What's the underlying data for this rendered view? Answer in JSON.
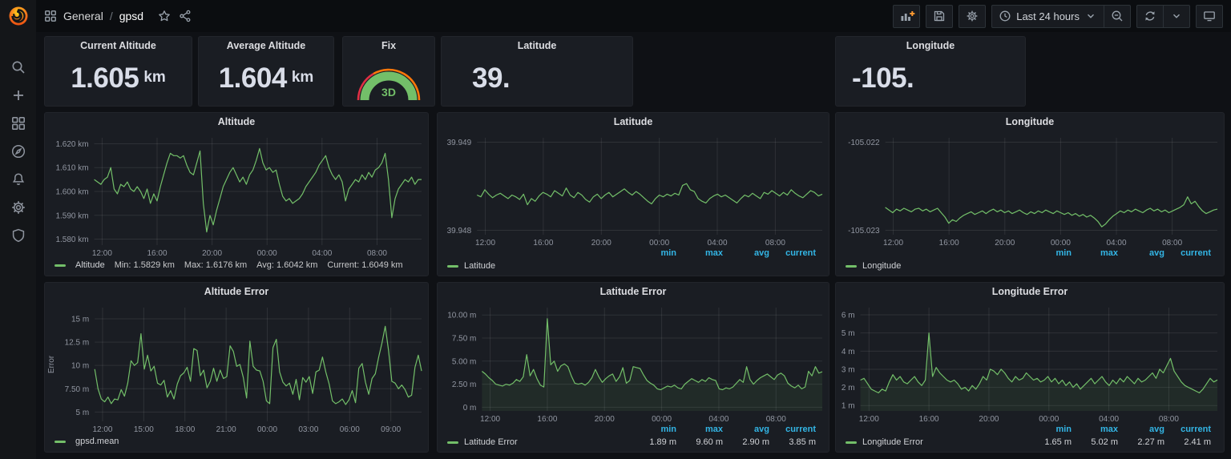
{
  "topbar": {
    "breadcrumb_section": "General",
    "breadcrumb_separator": "/",
    "breadcrumb_page": "gpsd",
    "time_range": "Last 24 hours"
  },
  "colors": {
    "series_green": "#73bf69",
    "legend_header_blue": "#33b5e5",
    "gauge_red": "#e02f44",
    "gauge_orange": "#ff780a",
    "add_panel_plus_orange": "#ff9830"
  },
  "stats": [
    {
      "title": "Current Altitude",
      "value": "1.605",
      "unit": "km"
    },
    {
      "title": "Average Altitude",
      "value": "1.604",
      "unit": "km"
    },
    {
      "title": "Fix",
      "value": "3D"
    },
    {
      "title": "Latitude",
      "value": "39."
    },
    {
      "title": "Longitude",
      "value": "-105."
    }
  ],
  "chart_data": [
    {
      "type": "line",
      "title": "Altitude",
      "color": "#73bf69",
      "fill": false,
      "ylim": [
        1.5775,
        1.6225
      ],
      "y_ticks": [
        {
          "v": 1.58,
          "label": "1.580 km"
        },
        {
          "v": 1.59,
          "label": "1.590 km"
        },
        {
          "v": 1.6,
          "label": "1.600 km"
        },
        {
          "v": 1.61,
          "label": "1.610 km"
        },
        {
          "v": 1.62,
          "label": "1.620 km"
        }
      ],
      "x_ticks": [
        "12:00",
        "16:00",
        "20:00",
        "00:00",
        "04:00",
        "08:00"
      ],
      "x_start": 0.024,
      "x_step": 0.168,
      "values": [
        1.605,
        1.604,
        1.603,
        1.605,
        1.606,
        1.61,
        1.601,
        1.599,
        1.603,
        1.602,
        1.604,
        1.601,
        1.6,
        1.602,
        1.6,
        1.597,
        1.601,
        1.595,
        1.599,
        1.596,
        1.602,
        1.607,
        1.612,
        1.616,
        1.615,
        1.615,
        1.614,
        1.615,
        1.611,
        1.608,
        1.607,
        1.612,
        1.617,
        1.595,
        1.583,
        1.59,
        1.586,
        1.592,
        1.597,
        1.602,
        1.605,
        1.608,
        1.61,
        1.607,
        1.604,
        1.606,
        1.603,
        1.607,
        1.609,
        1.613,
        1.618,
        1.612,
        1.609,
        1.61,
        1.608,
        1.609,
        1.603,
        1.598,
        1.596,
        1.597,
        1.595,
        1.596,
        1.597,
        1.599,
        1.602,
        1.604,
        1.606,
        1.608,
        1.611,
        1.613,
        1.615,
        1.61,
        1.607,
        1.605,
        1.607,
        1.604,
        1.596,
        1.601,
        1.603,
        1.605,
        1.604,
        1.607,
        1.605,
        1.608,
        1.606,
        1.609,
        1.61,
        1.612,
        1.616,
        1.605,
        1.589,
        1.597,
        1.601,
        1.603,
        1.605,
        1.604,
        1.606,
        1.603,
        1.605,
        1.605
      ],
      "legend": {
        "style": "inline",
        "label": "Altitude",
        "stats": [
          "Min: 1.5829 km",
          "Max: 1.6176 km",
          "Avg: 1.6042 km",
          "Current: 1.6049 km"
        ]
      }
    },
    {
      "type": "line",
      "title": "Latitude",
      "color": "#73bf69",
      "fill": false,
      "ylim": [
        39.94795,
        39.94905
      ],
      "y_ticks": [
        {
          "v": 39.948,
          "label": "39.948"
        },
        {
          "v": 39.949,
          "label": "39.949"
        }
      ],
      "x_ticks": [
        "12:00",
        "16:00",
        "20:00",
        "00:00",
        "04:00",
        "08:00"
      ],
      "x_start": 0.024,
      "x_step": 0.168,
      "values": [
        39.9484,
        39.94838,
        39.94846,
        39.94841,
        39.94837,
        39.9484,
        39.94842,
        39.94839,
        39.94836,
        39.9484,
        39.94838,
        39.94835,
        39.94841,
        39.94829,
        39.94836,
        39.94833,
        39.94839,
        39.94843,
        39.94841,
        39.94838,
        39.94845,
        39.94842,
        39.94839,
        39.94848,
        39.9484,
        39.94837,
        39.94843,
        39.9484,
        39.94835,
        39.94832,
        39.94838,
        39.94841,
        39.94836,
        39.9484,
        39.94843,
        39.94838,
        39.94841,
        39.94844,
        39.94847,
        39.94843,
        39.9484,
        39.94844,
        39.94841,
        39.94837,
        39.94833,
        39.9483,
        39.94836,
        39.9484,
        39.94838,
        39.94841,
        39.94839,
        39.94842,
        39.9484,
        39.94851,
        39.94853,
        39.94846,
        39.94844,
        39.94836,
        39.94833,
        39.94831,
        39.94836,
        39.94839,
        39.94841,
        39.94838,
        39.9484,
        39.94837,
        39.94834,
        39.94831,
        39.94836,
        39.9484,
        39.94838,
        39.94842,
        39.94839,
        39.94836,
        39.94843,
        39.94841,
        39.94845,
        39.94842,
        39.94839,
        39.94843,
        39.9484,
        39.94846,
        39.94842,
        39.94839,
        39.94837,
        39.94841,
        39.94845,
        39.94843,
        39.94839,
        39.94841
      ],
      "legend": {
        "style": "table",
        "label": "Latitude",
        "headers": [
          "min",
          "max",
          "avg",
          "current"
        ],
        "values": [
          "",
          "",
          "",
          ""
        ]
      }
    },
    {
      "type": "line",
      "title": "Longitude",
      "color": "#73bf69",
      "fill": false,
      "ylim": [
        -105.02305,
        -105.02195
      ],
      "y_ticks": [
        {
          "v": -105.023,
          "label": "-105.023"
        },
        {
          "v": -105.022,
          "label": "-105.022"
        }
      ],
      "x_ticks": [
        "12:00",
        "16:00",
        "20:00",
        "00:00",
        "04:00",
        "08:00"
      ],
      "x_start": 0.024,
      "x_step": 0.168,
      "values": [
        -105.02274,
        -105.02277,
        -105.0228,
        -105.02276,
        -105.02278,
        -105.02275,
        -105.02277,
        -105.02279,
        -105.02276,
        -105.02275,
        -105.02278,
        -105.02276,
        -105.02279,
        -105.02277,
        -105.02275,
        -105.0228,
        -105.02285,
        -105.02292,
        -105.02288,
        -105.0229,
        -105.02286,
        -105.02283,
        -105.02281,
        -105.02279,
        -105.02282,
        -105.0228,
        -105.02278,
        -105.02281,
        -105.02278,
        -105.02276,
        -105.02279,
        -105.02277,
        -105.0228,
        -105.02278,
        -105.02281,
        -105.02279,
        -105.02277,
        -105.0228,
        -105.02282,
        -105.02279,
        -105.02281,
        -105.02278,
        -105.0228,
        -105.02277,
        -105.02279,
        -105.02281,
        -105.02278,
        -105.0228,
        -105.02282,
        -105.0228,
        -105.02283,
        -105.02281,
        -105.02284,
        -105.02282,
        -105.02285,
        -105.02283,
        -105.02286,
        -105.0229,
        -105.02296,
        -105.02293,
        -105.02288,
        -105.02284,
        -105.02281,
        -105.02278,
        -105.0228,
        -105.02277,
        -105.02279,
        -105.02276,
        -105.02278,
        -105.0228,
        -105.02277,
        -105.02275,
        -105.02278,
        -105.02276,
        -105.02279,
        -105.02277,
        -105.0228,
        -105.02278,
        -105.02276,
        -105.02274,
        -105.02271,
        -105.02262,
        -105.0227,
        -105.02267,
        -105.02273,
        -105.02278,
        -105.02281,
        -105.02279,
        -105.02277,
        -105.02276
      ],
      "legend": {
        "style": "table",
        "label": "Longitude",
        "headers": [
          "min",
          "max",
          "avg",
          "current"
        ],
        "values": [
          "",
          "",
          "",
          ""
        ]
      }
    },
    {
      "type": "line",
      "title": "Altitude Error",
      "color": "#73bf69",
      "fill": false,
      "y_label": "Error",
      "ylim": [
        4.0,
        16.2
      ],
      "y_ticks": [
        {
          "v": 5,
          "label": "5 m"
        },
        {
          "v": 7.5,
          "label": "7.50 m"
        },
        {
          "v": 10,
          "label": "10 m"
        },
        {
          "v": 12.5,
          "label": "12.5 m"
        },
        {
          "v": 15,
          "label": "15 m"
        }
      ],
      "x_ticks": [
        "12:00",
        "15:00",
        "18:00",
        "21:00",
        "00:00",
        "03:00",
        "06:00",
        "09:00"
      ],
      "x_start": 0.024,
      "x_step": 0.126,
      "values": [
        9.6,
        7.5,
        6.4,
        6.1,
        6.6,
        5.9,
        6.4,
        6.3,
        7.4,
        6.7,
        8.1,
        10.5,
        10.0,
        10.3,
        13.4,
        9.6,
        11.1,
        9.4,
        9.9,
        8.1,
        7.9,
        8.4,
        6.6,
        7.3,
        6.4,
        8.0,
        8.9,
        9.2,
        9.8,
        8.3,
        11.8,
        11.6,
        8.9,
        9.5,
        7.6,
        8.3,
        9.7,
        8.3,
        9.5,
        8.6,
        8.8,
        12.1,
        11.5,
        9.9,
        10.1,
        8.7,
        6.5,
        12.6,
        9.9,
        9.5,
        9.4,
        8.3,
        6.2,
        5.9,
        11.9,
        12.8,
        9.3,
        8.2,
        7.8,
        8.1,
        6.9,
        8.5,
        6.3,
        8.7,
        8.2,
        8.8,
        7.0,
        9.3,
        9.5,
        10.9,
        9.3,
        8.0,
        6.2,
        5.9,
        6.1,
        6.4,
        5.8,
        6.3,
        7.3,
        6.0,
        9.7,
        10.2,
        8.2,
        6.9,
        8.6,
        9.1,
        10.9,
        12.4,
        14.2,
        11.6,
        8.3,
        8.1,
        7.5,
        7.9,
        7.4,
        6.6,
        6.8,
        9.8,
        11.1,
        9.4
      ],
      "legend": {
        "style": "inline",
        "label": "gpsd.mean",
        "stats": []
      }
    },
    {
      "type": "line",
      "title": "Latitude Error",
      "color": "#73bf69",
      "fill": true,
      "ylim": [
        -0.4,
        10.8
      ],
      "y_ticks": [
        {
          "v": 0,
          "label": "0 m"
        },
        {
          "v": 2.5,
          "label": "2.50 m"
        },
        {
          "v": 5,
          "label": "5.00 m"
        },
        {
          "v": 7.5,
          "label": "7.50 m"
        },
        {
          "v": 10,
          "label": "10.00 m"
        }
      ],
      "x_ticks": [
        "12:00",
        "16:00",
        "20:00",
        "00:00",
        "04:00",
        "08:00"
      ],
      "x_start": 0.024,
      "x_step": 0.168,
      "values": [
        3.9,
        3.6,
        3.2,
        2.9,
        2.5,
        2.4,
        2.3,
        2.5,
        2.4,
        2.6,
        3.0,
        2.8,
        3.3,
        5.7,
        3.4,
        4.1,
        3.1,
        2.4,
        2.2,
        9.6,
        4.6,
        5.0,
        3.9,
        4.5,
        4.7,
        4.4,
        3.4,
        2.6,
        2.5,
        2.6,
        2.4,
        2.7,
        3.2,
        4.1,
        3.3,
        2.7,
        3.1,
        3.4,
        3.6,
        2.8,
        3.3,
        4.3,
        2.6,
        2.9,
        4.4,
        4.3,
        4.2,
        3.5,
        2.9,
        2.6,
        2.4,
        2.0,
        1.9,
        2.1,
        2.3,
        2.2,
        2.4,
        2.1,
        2.0,
        2.5,
        2.8,
        3.1,
        2.9,
        2.7,
        3.0,
        2.8,
        3.2,
        3.0,
        2.9,
        2.0,
        1.9,
        2.1,
        2.0,
        2.2,
        2.6,
        3.0,
        2.7,
        4.4,
        3.0,
        2.5,
        2.9,
        3.2,
        3.4,
        3.6,
        3.3,
        3.0,
        3.5,
        3.7,
        3.4,
        2.6,
        2.3,
        2.1,
        2.4,
        2.0,
        2.2,
        3.9,
        3.4,
        4.4,
        3.7,
        3.85
      ],
      "legend": {
        "style": "table",
        "label": "Latitude Error",
        "headers": [
          "min",
          "max",
          "avg",
          "current"
        ],
        "values": [
          "1.89 m",
          "9.60 m",
          "2.90 m",
          "3.85 m"
        ]
      }
    },
    {
      "type": "line",
      "title": "Longitude Error",
      "color": "#73bf69",
      "fill": true,
      "ylim": [
        0.7,
        6.4
      ],
      "y_ticks": [
        {
          "v": 1,
          "label": "1 m"
        },
        {
          "v": 2,
          "label": "2 m"
        },
        {
          "v": 3,
          "label": "3 m"
        },
        {
          "v": 4,
          "label": "4 m"
        },
        {
          "v": 5,
          "label": "5 m"
        },
        {
          "v": 6,
          "label": "6 m"
        }
      ],
      "x_ticks": [
        "12:00",
        "16:00",
        "20:00",
        "00:00",
        "04:00",
        "08:00"
      ],
      "x_start": 0.024,
      "x_step": 0.168,
      "values": [
        2.4,
        2.5,
        2.2,
        1.9,
        1.8,
        1.7,
        1.9,
        1.8,
        2.3,
        2.7,
        2.4,
        2.6,
        2.3,
        2.2,
        2.4,
        2.6,
        2.3,
        2.1,
        2.4,
        5.0,
        2.6,
        3.1,
        2.8,
        2.6,
        2.4,
        2.3,
        2.4,
        2.2,
        1.9,
        2.0,
        1.8,
        2.1,
        1.9,
        2.2,
        2.6,
        2.4,
        3.0,
        2.9,
        2.7,
        3.0,
        2.8,
        2.5,
        2.3,
        2.6,
        2.4,
        2.5,
        2.8,
        2.6,
        2.4,
        2.5,
        2.3,
        2.4,
        2.6,
        2.3,
        2.5,
        2.2,
        2.4,
        2.1,
        2.3,
        2.0,
        2.2,
        1.9,
        2.1,
        2.3,
        2.5,
        2.2,
        2.4,
        2.6,
        2.3,
        2.1,
        2.4,
        2.2,
        2.5,
        2.3,
        2.6,
        2.4,
        2.2,
        2.5,
        2.3,
        2.4,
        2.6,
        2.8,
        2.5,
        3.0,
        2.8,
        3.2,
        3.6,
        2.9,
        2.6,
        2.3,
        2.1,
        2.0,
        1.9,
        1.8,
        1.7,
        1.9,
        2.2,
        2.5,
        2.3,
        2.41
      ],
      "legend": {
        "style": "table",
        "label": "Longitude Error",
        "headers": [
          "min",
          "max",
          "avg",
          "current"
        ],
        "values": [
          "1.65 m",
          "5.02 m",
          "2.27 m",
          "2.41 m"
        ]
      }
    }
  ]
}
